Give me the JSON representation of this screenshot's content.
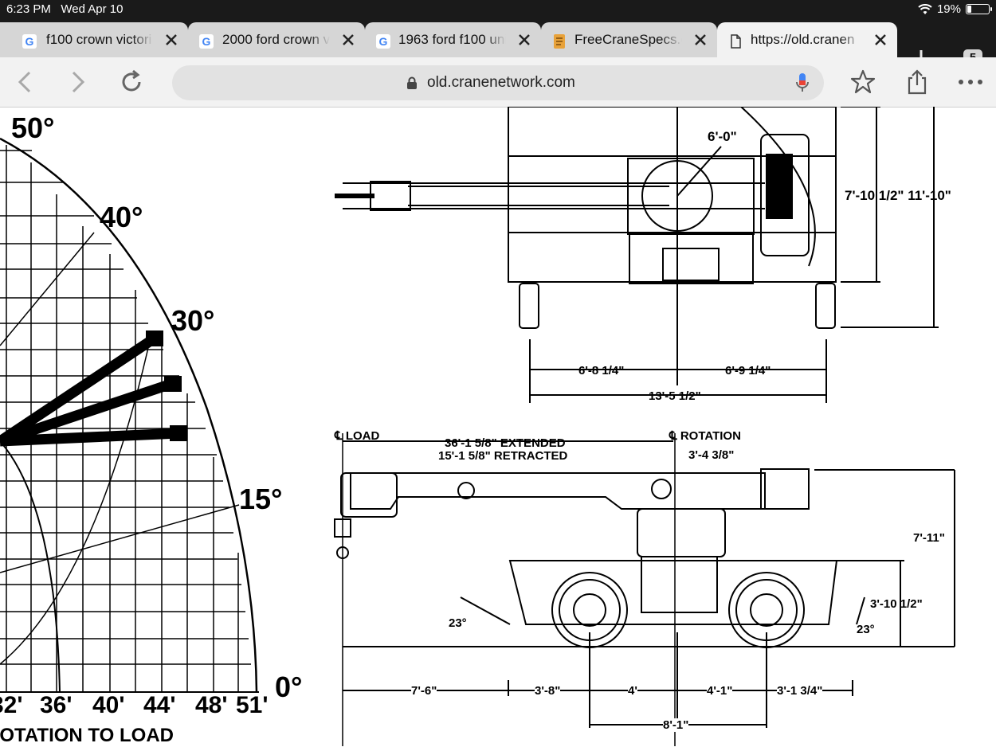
{
  "status": {
    "time": "6:23 PM",
    "date": "Wed Apr 10",
    "battery": "19%",
    "battery_level": 0.19
  },
  "tabs": [
    {
      "title": "f100 crown victori",
      "icon": "google-icon"
    },
    {
      "title": "2000 ford crown vi",
      "icon": "google-icon"
    },
    {
      "title": "1963 ford f100 uni",
      "icon": "google-icon"
    },
    {
      "title": "FreeCraneSpecs.c",
      "icon": "document-icon"
    },
    {
      "title": "https://old.cranen",
      "icon": "page-icon",
      "active": true
    }
  ],
  "tab_count": "5",
  "address": {
    "url": "old.cranenetwork.com"
  },
  "range_chart": {
    "angles": [
      "50°",
      "40°",
      "30°",
      "15°",
      "0°"
    ],
    "distances": [
      "32'",
      "36'",
      "40'",
      "44'",
      "48'",
      "51'"
    ],
    "bottom_label": "ROTATION TO LOAD"
  },
  "top_view": {
    "dims": {
      "turret": "6'-0\"",
      "heights": "7'-10 1/2\" 11'-10\"",
      "left_half": "6'-8 1/4\"",
      "right_half": "6'-9 1/4\"",
      "total_width": "13'-5 1/2\""
    }
  },
  "side_view": {
    "load_label": "LOAD",
    "rotation_label": "ROTATION",
    "extended": "36'-1 5/8\" EXTENDED",
    "retracted": "15'-1 5/8\" RETRACTED",
    "rot_offset": "3'-4 3/8\"",
    "height_total": "7'-11\"",
    "height_deck": "3'-10 1/2\"",
    "angle_left": "23°",
    "angle_right": "23°",
    "d1": "7'-6\"",
    "d2": "3'-8\"",
    "d3": "4'",
    "d4": "4'-1\"",
    "d5": "3'-1 3/4\"",
    "wheelbase": "8'-1\""
  }
}
